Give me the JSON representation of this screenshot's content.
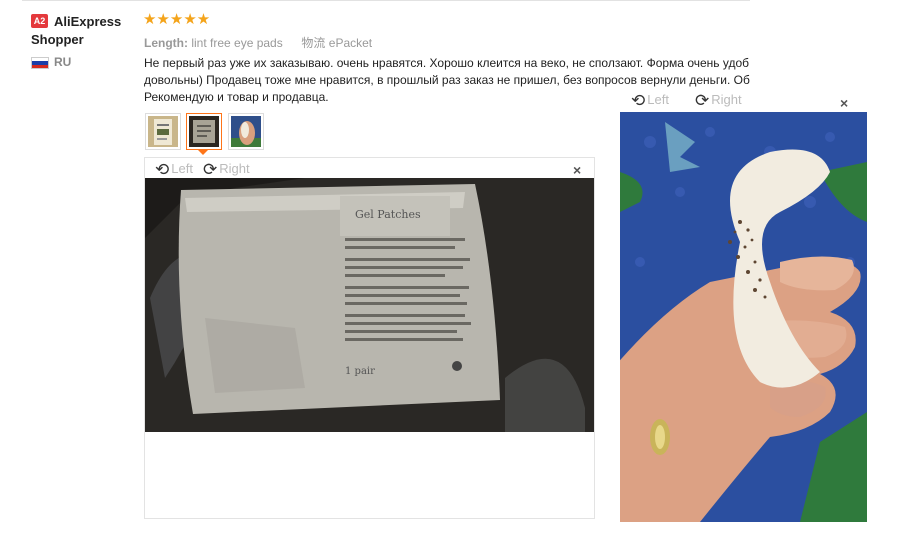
{
  "reviewer": {
    "badge": "A2",
    "name": "AliExpress Shopper",
    "country": "RU",
    "flag_colors": [
      "#ffffff",
      "#1c3fa8",
      "#d52b1e"
    ]
  },
  "review": {
    "stars": "★★★★★",
    "star_color": "#f4a41b",
    "rating": 5,
    "attr_length_label": "Length:",
    "attr_length_value": "lint free eye pads",
    "attr_ship_label": "物流",
    "attr_ship_value": "ePacket",
    "text_lines": [
      "Не первый раз уже их заказываю. очень нравятся. Хорошо клеится на веко, не сползают. Форма очень удоб",
      "довольны) Продавец тоже мне нравится, в прошлый раз заказ не пришел, без вопросов вернули деньги. Об",
      "Рекомендую и товар и продавца."
    ]
  },
  "thumbnails": [
    {
      "name": "thumbnail-1",
      "active": false
    },
    {
      "name": "thumbnail-2",
      "active": true
    },
    {
      "name": "thumbnail-3",
      "active": false
    }
  ],
  "viewer_main": {
    "rotate_left_label": "Left",
    "rotate_right_label": "Right",
    "close_label": "×",
    "rotate_left_icon": "rotate-left-icon",
    "rotate_right_icon": "rotate-right-icon"
  },
  "viewer_side": {
    "rotate_left_label": "Left",
    "rotate_right_label": "Right",
    "close_label": "×"
  },
  "photo_package": {
    "text_title": "Gel Patches",
    "text_footer": "1 pair"
  },
  "colors": {
    "accent_orange": "#ff7519",
    "badge_red": "#e4393c",
    "muted": "#999999"
  }
}
